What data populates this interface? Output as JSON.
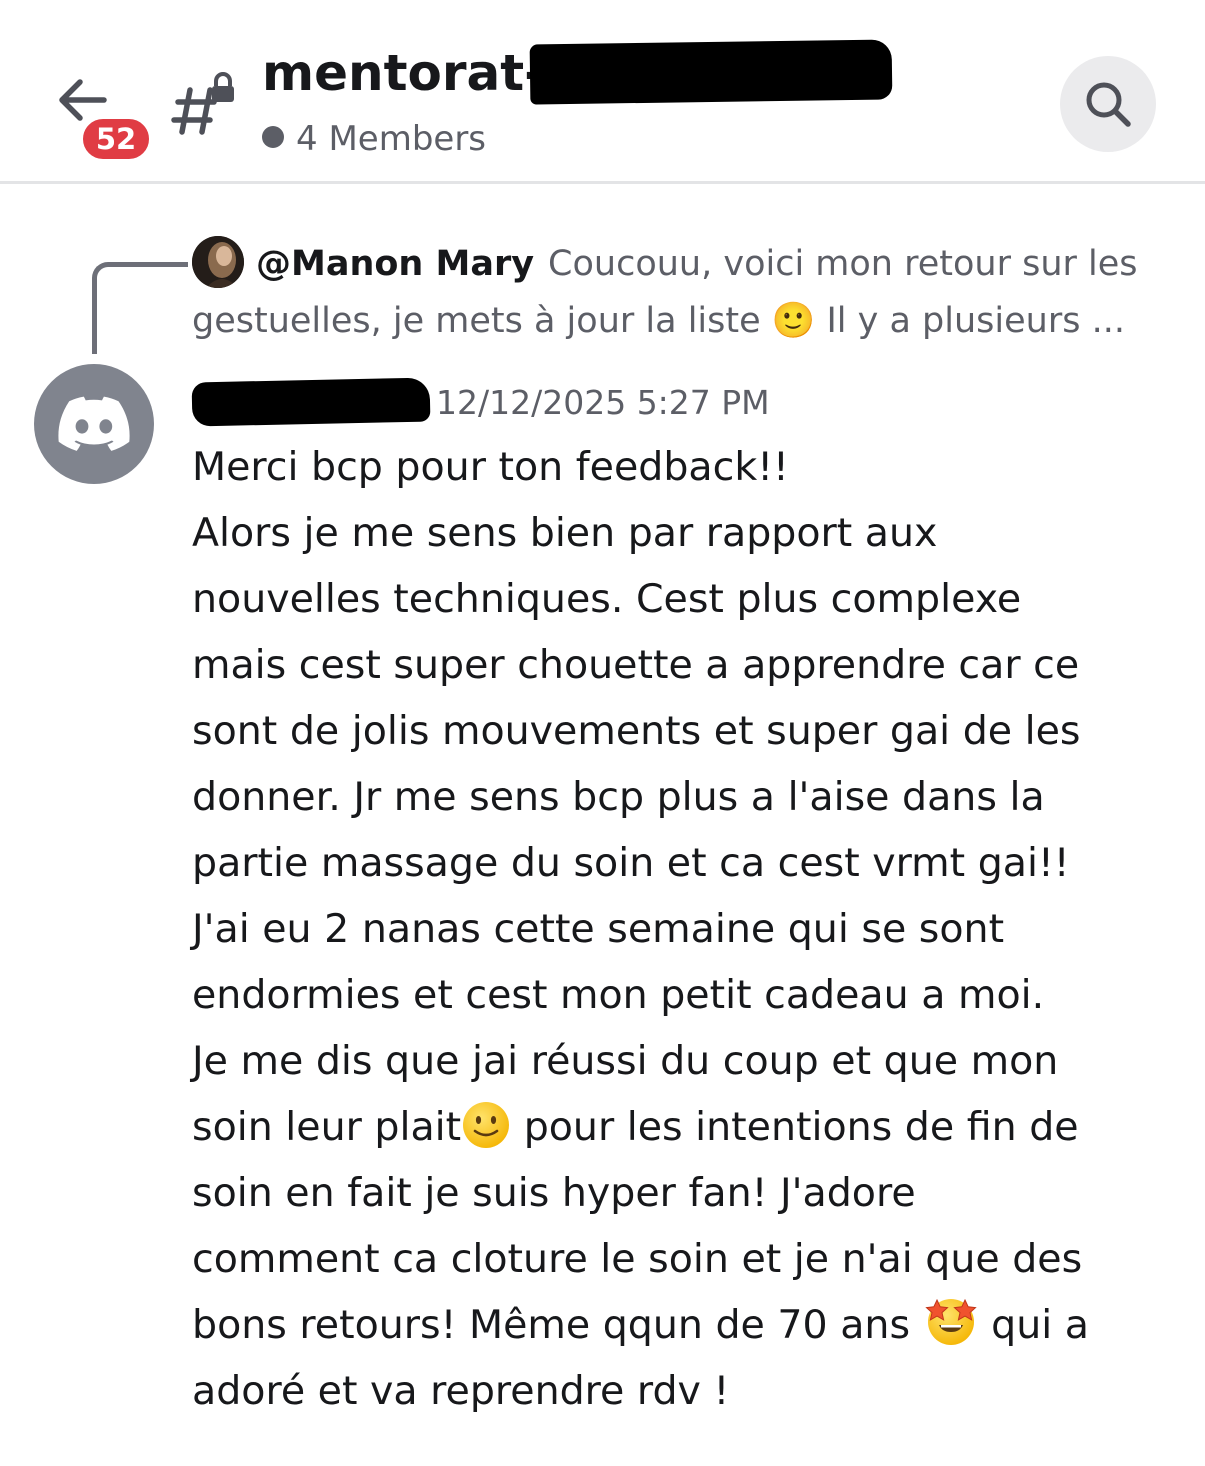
{
  "header": {
    "back_label": "Back",
    "unread_badge": "52",
    "channel_name": "mentorat-c",
    "members": "4 Members"
  },
  "reply": {
    "author": "@Manon Mary",
    "preview": "Coucouu, voici mon retour sur les gestuelles, je mets à jour la liste 🙂 Il y a plusieurs ..."
  },
  "message": {
    "timestamp": "12/12/2025 5:27 PM",
    "lines": [
      "Merci bcp pour ton feedback!!",
      "Alors je me sens bien par rapport aux",
      "nouvelles techniques. Cest plus complexe",
      "mais cest super chouette a apprendre car ce",
      "sont de jolis mouvements et super gai de les",
      "donner. Jr me sens bcp plus a l'aise dans la",
      "partie massage du soin et ca cest vrmt gai!!",
      "J'ai eu 2 nanas cette semaine qui se sont",
      "endormies et cest mon petit cadeau a moi.",
      "Je me dis que jai réussi du coup et que mon",
      "soin leur plait",
      " pour les intentions de fin de",
      "soin en fait je suis hyper fan! J'adore",
      "comment ca cloture le soin et je n'ai que des",
      "bons retours! Même qqun de 70 ans ",
      " qui a",
      "adoré et va reprendre rdv !"
    ]
  },
  "icons": {
    "back": "arrow-left-icon",
    "channel": "locked-text-channel-icon",
    "search": "search-icon",
    "avatar": "discord-default-avatar-icon",
    "emoji_smile": "slightly-smiling-face-emoji",
    "emoji_star": "star-struck-emoji"
  },
  "colors": {
    "badge": "#e03c44",
    "default_avatar": "#80848e",
    "muted_text": "#5c5e66",
    "main_text": "#17181b"
  }
}
